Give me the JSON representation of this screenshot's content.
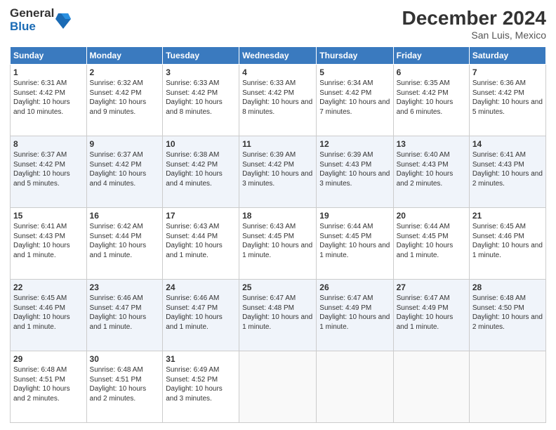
{
  "logo": {
    "general": "General",
    "blue": "Blue"
  },
  "header": {
    "title": "December 2024",
    "subtitle": "San Luis, Mexico"
  },
  "weekdays": [
    "Sunday",
    "Monday",
    "Tuesday",
    "Wednesday",
    "Thursday",
    "Friday",
    "Saturday"
  ],
  "weeks": [
    [
      {
        "day": "1",
        "sunrise": "Sunrise: 6:31 AM",
        "sunset": "Sunset: 4:42 PM",
        "daylight": "Daylight: 10 hours and 10 minutes."
      },
      {
        "day": "2",
        "sunrise": "Sunrise: 6:32 AM",
        "sunset": "Sunset: 4:42 PM",
        "daylight": "Daylight: 10 hours and 9 minutes."
      },
      {
        "day": "3",
        "sunrise": "Sunrise: 6:33 AM",
        "sunset": "Sunset: 4:42 PM",
        "daylight": "Daylight: 10 hours and 8 minutes."
      },
      {
        "day": "4",
        "sunrise": "Sunrise: 6:33 AM",
        "sunset": "Sunset: 4:42 PM",
        "daylight": "Daylight: 10 hours and 8 minutes."
      },
      {
        "day": "5",
        "sunrise": "Sunrise: 6:34 AM",
        "sunset": "Sunset: 4:42 PM",
        "daylight": "Daylight: 10 hours and 7 minutes."
      },
      {
        "day": "6",
        "sunrise": "Sunrise: 6:35 AM",
        "sunset": "Sunset: 4:42 PM",
        "daylight": "Daylight: 10 hours and 6 minutes."
      },
      {
        "day": "7",
        "sunrise": "Sunrise: 6:36 AM",
        "sunset": "Sunset: 4:42 PM",
        "daylight": "Daylight: 10 hours and 5 minutes."
      }
    ],
    [
      {
        "day": "8",
        "sunrise": "Sunrise: 6:37 AM",
        "sunset": "Sunset: 4:42 PM",
        "daylight": "Daylight: 10 hours and 5 minutes."
      },
      {
        "day": "9",
        "sunrise": "Sunrise: 6:37 AM",
        "sunset": "Sunset: 4:42 PM",
        "daylight": "Daylight: 10 hours and 4 minutes."
      },
      {
        "day": "10",
        "sunrise": "Sunrise: 6:38 AM",
        "sunset": "Sunset: 4:42 PM",
        "daylight": "Daylight: 10 hours and 4 minutes."
      },
      {
        "day": "11",
        "sunrise": "Sunrise: 6:39 AM",
        "sunset": "Sunset: 4:42 PM",
        "daylight": "Daylight: 10 hours and 3 minutes."
      },
      {
        "day": "12",
        "sunrise": "Sunrise: 6:39 AM",
        "sunset": "Sunset: 4:43 PM",
        "daylight": "Daylight: 10 hours and 3 minutes."
      },
      {
        "day": "13",
        "sunrise": "Sunrise: 6:40 AM",
        "sunset": "Sunset: 4:43 PM",
        "daylight": "Daylight: 10 hours and 2 minutes."
      },
      {
        "day": "14",
        "sunrise": "Sunrise: 6:41 AM",
        "sunset": "Sunset: 4:43 PM",
        "daylight": "Daylight: 10 hours and 2 minutes."
      }
    ],
    [
      {
        "day": "15",
        "sunrise": "Sunrise: 6:41 AM",
        "sunset": "Sunset: 4:43 PM",
        "daylight": "Daylight: 10 hours and 1 minute."
      },
      {
        "day": "16",
        "sunrise": "Sunrise: 6:42 AM",
        "sunset": "Sunset: 4:44 PM",
        "daylight": "Daylight: 10 hours and 1 minute."
      },
      {
        "day": "17",
        "sunrise": "Sunrise: 6:43 AM",
        "sunset": "Sunset: 4:44 PM",
        "daylight": "Daylight: 10 hours and 1 minute."
      },
      {
        "day": "18",
        "sunrise": "Sunrise: 6:43 AM",
        "sunset": "Sunset: 4:45 PM",
        "daylight": "Daylight: 10 hours and 1 minute."
      },
      {
        "day": "19",
        "sunrise": "Sunrise: 6:44 AM",
        "sunset": "Sunset: 4:45 PM",
        "daylight": "Daylight: 10 hours and 1 minute."
      },
      {
        "day": "20",
        "sunrise": "Sunrise: 6:44 AM",
        "sunset": "Sunset: 4:45 PM",
        "daylight": "Daylight: 10 hours and 1 minute."
      },
      {
        "day": "21",
        "sunrise": "Sunrise: 6:45 AM",
        "sunset": "Sunset: 4:46 PM",
        "daylight": "Daylight: 10 hours and 1 minute."
      }
    ],
    [
      {
        "day": "22",
        "sunrise": "Sunrise: 6:45 AM",
        "sunset": "Sunset: 4:46 PM",
        "daylight": "Daylight: 10 hours and 1 minute."
      },
      {
        "day": "23",
        "sunrise": "Sunrise: 6:46 AM",
        "sunset": "Sunset: 4:47 PM",
        "daylight": "Daylight: 10 hours and 1 minute."
      },
      {
        "day": "24",
        "sunrise": "Sunrise: 6:46 AM",
        "sunset": "Sunset: 4:47 PM",
        "daylight": "Daylight: 10 hours and 1 minute."
      },
      {
        "day": "25",
        "sunrise": "Sunrise: 6:47 AM",
        "sunset": "Sunset: 4:48 PM",
        "daylight": "Daylight: 10 hours and 1 minute."
      },
      {
        "day": "26",
        "sunrise": "Sunrise: 6:47 AM",
        "sunset": "Sunset: 4:49 PM",
        "daylight": "Daylight: 10 hours and 1 minute."
      },
      {
        "day": "27",
        "sunrise": "Sunrise: 6:47 AM",
        "sunset": "Sunset: 4:49 PM",
        "daylight": "Daylight: 10 hours and 1 minute."
      },
      {
        "day": "28",
        "sunrise": "Sunrise: 6:48 AM",
        "sunset": "Sunset: 4:50 PM",
        "daylight": "Daylight: 10 hours and 2 minutes."
      }
    ],
    [
      {
        "day": "29",
        "sunrise": "Sunrise: 6:48 AM",
        "sunset": "Sunset: 4:51 PM",
        "daylight": "Daylight: 10 hours and 2 minutes."
      },
      {
        "day": "30",
        "sunrise": "Sunrise: 6:48 AM",
        "sunset": "Sunset: 4:51 PM",
        "daylight": "Daylight: 10 hours and 2 minutes."
      },
      {
        "day": "31",
        "sunrise": "Sunrise: 6:49 AM",
        "sunset": "Sunset: 4:52 PM",
        "daylight": "Daylight: 10 hours and 3 minutes."
      },
      null,
      null,
      null,
      null
    ]
  ]
}
